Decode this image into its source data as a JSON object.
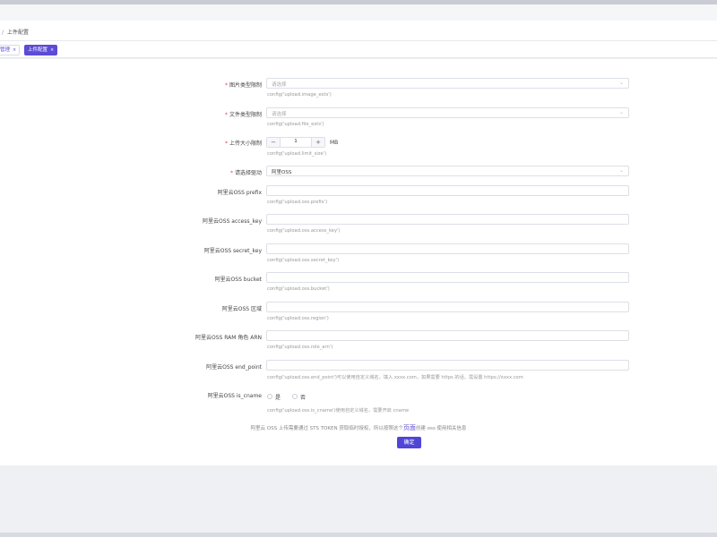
{
  "breadcrumb": {
    "separator": "/",
    "current": "上件配置"
  },
  "tabs": [
    {
      "label": "管理",
      "close": "×"
    },
    {
      "label": "上件配置",
      "close": "×"
    }
  ],
  "form": {
    "image_types": {
      "label": "图片类型限制",
      "required": "*",
      "placeholder": "请选择",
      "hint": "config('upload.image_exts')"
    },
    "file_types": {
      "label": "文件类型限制",
      "required": "*",
      "placeholder": "请选择",
      "hint": "config('upload.file_exts')"
    },
    "size_limit": {
      "label": "上传大小限制",
      "required": "*",
      "value": "1",
      "unit": "MB",
      "minus": "−",
      "plus": "+",
      "hint": "config('upload.limit_size')"
    },
    "driver": {
      "label": "请选择驱动",
      "required": "*",
      "value": "阿里OSS"
    },
    "prefix": {
      "label": "阿里云OSS prefix",
      "hint": "config('upload.oss.prefix')"
    },
    "access_key": {
      "label": "阿里云OSS access_key",
      "hint": "config('upload.oss.access_key')"
    },
    "secret_key": {
      "label": "阿里云OSS secret_key",
      "hint": "config('upload.oss.secret_key')"
    },
    "bucket": {
      "label": "阿里云OSS bucket",
      "hint": "config('upload.oss.bucket')"
    },
    "region": {
      "label": "阿里云OSS 区域",
      "hint": "config('upload.oss.region')"
    },
    "role_arn": {
      "label": "阿里云OSS RAM 角色 ARN",
      "hint": "config('upload.oss.role_arn')"
    },
    "end_point": {
      "label": "阿里云OSS end_point",
      "hint": "config('upload.oss.end_point')可以使用自定义域名，填入 xxxx.com，如果需要 https 的话，需设置 https://xxxx.com"
    },
    "is_cname": {
      "label": "阿里云OSS is_cname",
      "option_yes": "是",
      "option_no": "否",
      "hint": "config('upload.oss.is_cname')使用自定义域名，需要开启 cname"
    }
  },
  "notice": {
    "before": "阿里云 OSS 上传需要通过 STS TOKEN 获取临时授权，所以按照这个",
    "link": "页面",
    "after": "创建 oss 使用相关信息"
  },
  "submit_label": "确定",
  "icons": {
    "chevron": "chevron-down-icon",
    "close": "close-icon"
  },
  "colors": {
    "accent": "#4f46d6",
    "required": "#e5484d"
  }
}
